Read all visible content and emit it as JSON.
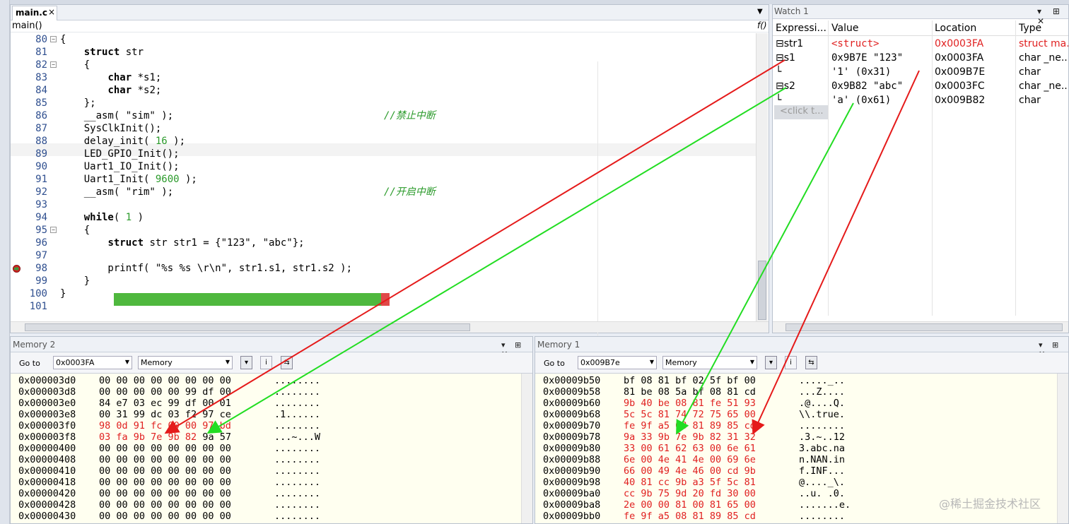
{
  "editor": {
    "tab_label": "main.c",
    "tab_close": "×",
    "dropdown_arrow": "▼",
    "function_label": "main()",
    "function_icon": "f()",
    "lines": [
      {
        "num": "80",
        "fold": "⊟",
        "text": "{"
      },
      {
        "num": "81",
        "fold": "",
        "text": "    struct str",
        "kw": "struct"
      },
      {
        "num": "82",
        "fold": "⊟",
        "text": "    {"
      },
      {
        "num": "83",
        "fold": "",
        "text": "        char *s1;",
        "kw": "char"
      },
      {
        "num": "84",
        "fold": "",
        "text": "        char *s2;",
        "kw": "char"
      },
      {
        "num": "85",
        "fold": "",
        "text": "    };"
      },
      {
        "num": "86",
        "fold": "",
        "text": "    __asm( \"sim\" );",
        "comment": "//禁止中断"
      },
      {
        "num": "87",
        "fold": "",
        "text": "    SysClkInit();"
      },
      {
        "num": "88",
        "fold": "",
        "text": "    delay_init( 16 );",
        "number": "16"
      },
      {
        "num": "89",
        "fold": "",
        "text": "    LED_GPIO_Init();"
      },
      {
        "num": "90",
        "fold": "",
        "text": "    Uart1_IO_Init();"
      },
      {
        "num": "91",
        "fold": "",
        "text": "    Uart1_Init( 9600 );",
        "number": "9600"
      },
      {
        "num": "92",
        "fold": "",
        "text": "    __asm( \"rim\" );",
        "comment": "//开启中断"
      },
      {
        "num": "93",
        "fold": "",
        "text": ""
      },
      {
        "num": "94",
        "fold": "",
        "text": "    while( 1 )",
        "kw": "while",
        "number": "1"
      },
      {
        "num": "95",
        "fold": "⊟",
        "text": "    {"
      },
      {
        "num": "96",
        "fold": "",
        "text": "        struct str str1 = {\"123\", \"abc\"};",
        "kw": "struct"
      },
      {
        "num": "97",
        "fold": "",
        "text": ""
      },
      {
        "num": "98",
        "fold": "",
        "text": "        printf( \"%s %s \\r\\n\", str1.s1, str1.s2 );"
      },
      {
        "num": "99",
        "fold": "",
        "text": "    }"
      },
      {
        "num": "100",
        "fold": "",
        "text": "}"
      },
      {
        "num": "101",
        "fold": "",
        "text": ""
      }
    ],
    "scroll_grip": "⦙"
  },
  "watch": {
    "title": "Watch 1",
    "controls": "▾ ⊞ ✕",
    "columns": [
      "Expressi...",
      "Value",
      "Location",
      "Type"
    ],
    "rows": [
      {
        "expr": "⊟str1",
        "value": "<struct>",
        "location": "0x0003FA",
        "type": "struct ma...",
        "red": true
      },
      {
        "expr": "  ⊟s1",
        "value": "0x9B7E \"123\"",
        "location": "0x0003FA",
        "type": "char _ne...",
        "red": false
      },
      {
        "expr": "     └",
        "value": "'1' (0x31)",
        "location": "0x009B7E",
        "type": "char",
        "red": false
      },
      {
        "expr": "  ⊟s2",
        "value": "0x9B82 \"abc\"",
        "location": "0x0003FC",
        "type": "char _ne...",
        "red": false
      },
      {
        "expr": "     └",
        "value": "'a' (0x61)",
        "location": "0x009B82",
        "type": "char",
        "red": false
      }
    ],
    "add_placeholder": "<click t..."
  },
  "memory2": {
    "title": "Memory 2",
    "controls": "▾ ⊞ ✕",
    "goto_label": "Go to",
    "address": "0x0003FA",
    "zone": "Memory",
    "rows": [
      {
        "addr": "0x000003d0",
        "bytes": "00 00 00 00 00 00 00 00",
        "ascii": "........"
      },
      {
        "addr": "0x000003d8",
        "bytes": "00 00 00 00 00 99 df 00",
        "ascii": "........"
      },
      {
        "addr": "0x000003e0",
        "bytes": "84 e7 03 ec 99 df 00 01",
        "ascii": "........"
      },
      {
        "addr": "0x000003e8",
        "bytes": "00 31 99 dc 03 f2 97 ce",
        "ascii": ".1......"
      },
      {
        "addr": "0x000003f0",
        "bytes": "98 0d 91 fc 00 00 97 bd",
        "ascii": "........",
        "red": true
      },
      {
        "addr": "0x000003f8",
        "bytes": "03 fa 9b 7e 9b 82",
        "bytes_tail": " 9a 57",
        "ascii": "...~...W",
        "red": true
      },
      {
        "addr": "0x00000400",
        "bytes": "00 00 00 00 00 00 00 00",
        "ascii": "........"
      },
      {
        "addr": "0x00000408",
        "bytes": "00 00 00 00 00 00 00 00",
        "ascii": "........"
      },
      {
        "addr": "0x00000410",
        "bytes": "00 00 00 00 00 00 00 00",
        "ascii": "........"
      },
      {
        "addr": "0x00000418",
        "bytes": "00 00 00 00 00 00 00 00",
        "ascii": "........"
      },
      {
        "addr": "0x00000420",
        "bytes": "00 00 00 00 00 00 00 00",
        "ascii": "........"
      },
      {
        "addr": "0x00000428",
        "bytes": "00 00 00 00 00 00 00 00",
        "ascii": "........"
      },
      {
        "addr": "0x00000430",
        "bytes": "00 00 00 00 00 00 00 00",
        "ascii": "........"
      }
    ]
  },
  "memory1": {
    "title": "Memory 1",
    "controls": "▾ ⊞ ✕",
    "goto_label": "Go to",
    "address": "0x009B7e",
    "zone": "Memory",
    "rows": [
      {
        "addr": "0x00009b50",
        "bytes": "bf 08 81 bf 02 5f bf 00",
        "ascii": "....._.."
      },
      {
        "addr": "0x00009b58",
        "bytes": "81 be 08 5a bf 08 81 cd",
        "ascii": "...Z...."
      },
      {
        "addr": "0x00009b60",
        "bytes": "9b 40 be 08 81 fe 51 93",
        "ascii": ".@....Q.",
        "red": true
      },
      {
        "addr": "0x00009b68",
        "bytes": "5c 5c 81 74 72 75 65 00",
        "ascii": "\\\\.true.",
        "red": true
      },
      {
        "addr": "0x00009b70",
        "bytes": "fe 9f a5 08 81 89 85 cd",
        "ascii": "........",
        "red": true
      },
      {
        "addr": "0x00009b78",
        "bytes": "9a 33 9b 7e 9b 82 31 32",
        "ascii": ".3.~..12",
        "red": true
      },
      {
        "addr": "0x00009b80",
        "bytes": "33 00 61 62 63 00 6e 61",
        "ascii": "3.abc.na",
        "red": true
      },
      {
        "addr": "0x00009b88",
        "bytes": "6e 00 4e 41 4e 00 69 6e",
        "ascii": "n.NAN.in",
        "red": true
      },
      {
        "addr": "0x00009b90",
        "bytes": "66 00 49 4e 46 00 cd 9b",
        "ascii": "f.INF...",
        "red": true
      },
      {
        "addr": "0x00009b98",
        "bytes": "40 81 cc 9b a3 5f 5c 81",
        "ascii": "@...._\\.",
        "red": true
      },
      {
        "addr": "0x00009ba0",
        "bytes": "cc 9b 75 9d 20 fd 30 00",
        "ascii": "..u. .0.",
        "red": true
      },
      {
        "addr": "0x00009ba8",
        "bytes": "2e 00 00 81 00 81 65 00",
        "ascii": ".......e.",
        "red": true
      },
      {
        "addr": "0x00009bb0",
        "bytes": "fe 9f a5 08 81 89 85 cd",
        "ascii": "........",
        "red": true
      }
    ]
  },
  "watermark": "@稀土掘金技术社区",
  "colors": {
    "arrow_red": "#e51a1a",
    "arrow_green": "#22dd22",
    "exec_green": "#4fb83e"
  }
}
